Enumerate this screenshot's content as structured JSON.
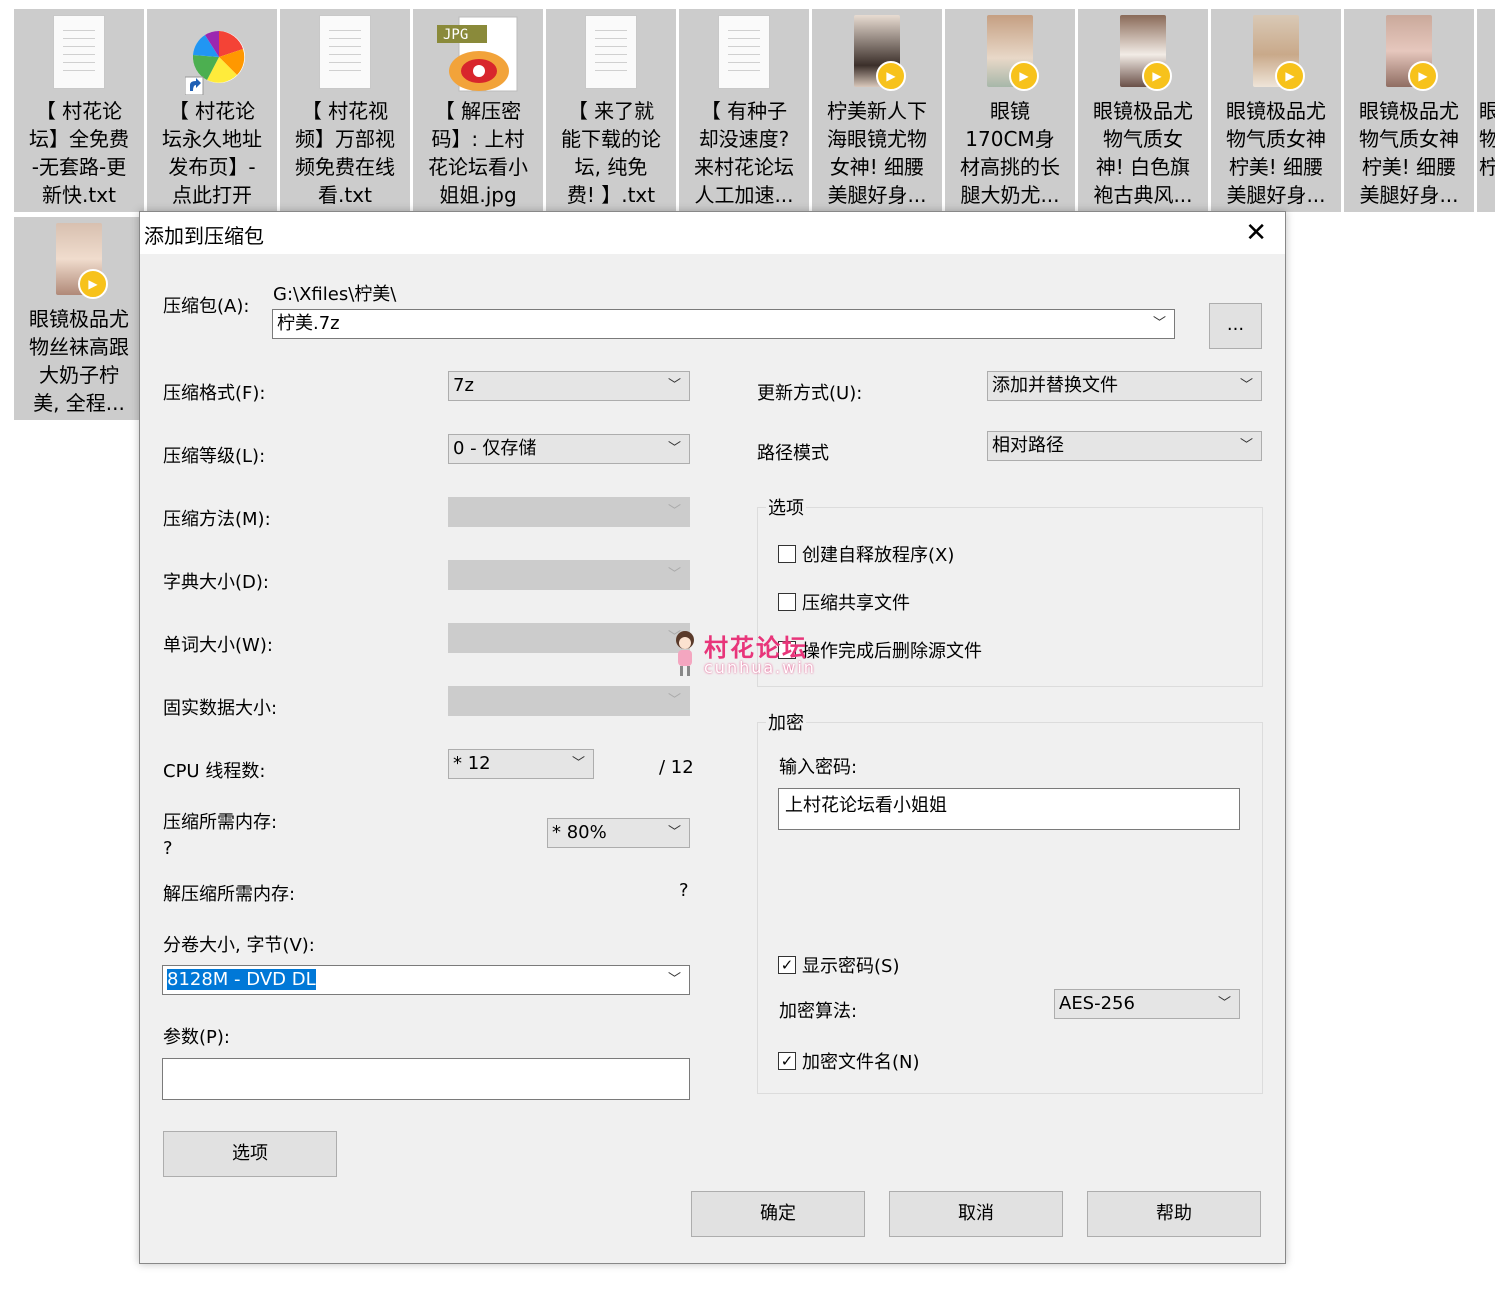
{
  "files": [
    {
      "name": "【 村花论\n坛】全免费\n-无套路-更\n新快.txt",
      "kind": "txt"
    },
    {
      "name": "【 村花论\n坛永久地址\n发布页】-\n点此打开",
      "kind": "shortcut"
    },
    {
      "name": "【 村花视\n频】万部视\n频免费在线\n看.txt",
      "kind": "txt"
    },
    {
      "name": "【 解压密\n码】: 上村\n花论坛看小\n姐姐.jpg",
      "kind": "jpg"
    },
    {
      "name": "【 来了就\n能下载的论\n坛, 纯免\n费! 】.txt",
      "kind": "txt"
    },
    {
      "name": "【 有种子\n却没速度?\n来村花论坛\n人工加速...",
      "kind": "txt"
    },
    {
      "name": "柠美新人下\n海眼镜尤物\n女神! 细腰\n美腿好身...",
      "kind": "video"
    },
    {
      "name": "眼镜\n170CM身\n材高挑的长\n腿大奶尤...",
      "kind": "video"
    },
    {
      "name": "眼镜极品尤\n物气质女\n神! 白色旗\n袍古典风...",
      "kind": "video"
    },
    {
      "name": "眼镜极品尤\n物气质女神\n柠美! 细腰\n美腿好身...",
      "kind": "video"
    },
    {
      "name": "眼镜极品尤\n物气质女神\n柠美! 细腰\n美腿好身...",
      "kind": "video"
    },
    {
      "name": "眼\n物\n柠",
      "kind": "video"
    },
    {
      "name": "眼镜极品尤\n物丝袜高跟\n大奶子柠\n美, 全程...",
      "kind": "video"
    }
  ],
  "dialog": {
    "title": "添加到压缩包",
    "archive_label": "压缩包(A):",
    "archive_path": "G:\\Xfiles\\柠美\\",
    "archive_name": "柠美.7z",
    "browse_label": "...",
    "format_label": "压缩格式(F):",
    "format_value": "7z",
    "level_label": "压缩等级(L):",
    "level_value": "0 - 仅存储",
    "method_label": "压缩方法(M):",
    "dict_label": "字典大小(D):",
    "word_label": "单词大小(W):",
    "solid_label": "固实数据大小:",
    "cpu_label": "CPU 线程数:",
    "cpu_value": "*  12",
    "cpu_total": "/ 12",
    "mem_comp_label": "压缩所需内存:",
    "mem_comp_value": "?",
    "mem_comp_percent": "* 80%",
    "mem_decomp_label": "解压缩所需内存:",
    "mem_decomp_value": "?",
    "volume_label": "分卷大小, 字节(V):",
    "volume_value": "8128M - DVD DL",
    "params_label": "参数(P):",
    "params_value": "",
    "options_button": "选项",
    "update_label": "更新方式(U):",
    "update_value": "添加并替换文件",
    "path_label": "路径模式",
    "path_value": "相对路径",
    "options_group": "选项",
    "opt_sfx": "创建自释放程序(X)",
    "opt_shared": "压缩共享文件",
    "opt_delete": "操作完成后删除源文件",
    "encrypt_group": "加密",
    "pwd_label": "输入密码:",
    "pwd_value": "上村花论坛看小姐姐",
    "show_pwd": "显示密码(S)",
    "algo_label": "加密算法:",
    "algo_value": "AES-256",
    "encrypt_names": "加密文件名(N)",
    "ok": "确定",
    "cancel": "取消",
    "help": "帮助"
  },
  "watermark": {
    "title": "村花论坛",
    "sub": "cunhua.win"
  },
  "colors": {
    "selection": "#0078d7",
    "dialog_bg": "#f0f0f0",
    "file_bg": "#cccccc",
    "play_badge": "#f7c21b",
    "watermark": "#e8357a"
  }
}
